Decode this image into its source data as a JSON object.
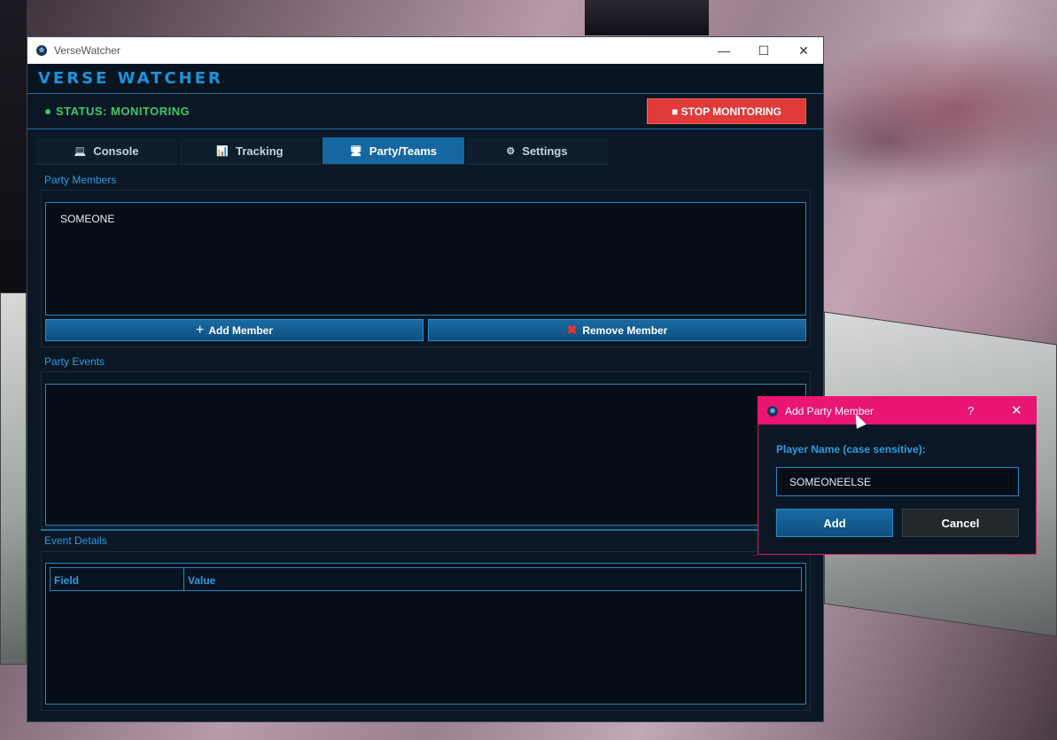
{
  "window": {
    "title": "VerseWatcher",
    "minimize": "—",
    "maximize": "☐",
    "close": "✕"
  },
  "header": {
    "app_name": "VERSE WATCHER"
  },
  "status": {
    "text": "STATUS: MONITORING",
    "stop_label": "■ STOP MONITORING"
  },
  "tabs": [
    {
      "icon": "💻",
      "label": "Console"
    },
    {
      "icon": "📊",
      "label": "Tracking"
    },
    {
      "icon": "🖥",
      "label": "Party/Teams"
    },
    {
      "icon": "⚙",
      "label": "Settings"
    }
  ],
  "party": {
    "members_label": "Party Members",
    "members": [
      "SOMEONE"
    ],
    "add_member_label": "Add Member",
    "remove_member_label": "Remove Member",
    "events_label": "Party Events",
    "details_label": "Event Details",
    "columns": [
      "Field",
      "Value"
    ]
  },
  "dialog": {
    "title": "Add Party Member",
    "help": "?",
    "close": "✕",
    "prompt": "Player Name (case sensitive):",
    "input_value": "SOMEONEELSE",
    "add_label": "Add",
    "cancel_label": "Cancel"
  },
  "colors": {
    "accent": "#1a93dc",
    "status_green": "#3ec86a",
    "stop_red": "#e03a3a",
    "dialog_pink": "#ea1473"
  }
}
